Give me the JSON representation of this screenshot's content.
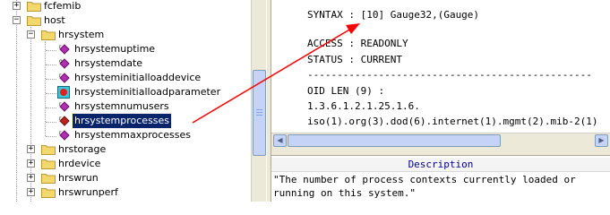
{
  "tree": {
    "nodes": [
      {
        "label": "fcfemib"
      },
      {
        "label": "host"
      },
      {
        "label": "hrsystem"
      },
      {
        "label": "hrsystemuptime"
      },
      {
        "label": "hrsystemdate"
      },
      {
        "label": "hrsysteminitialloaddevice"
      },
      {
        "label": "hrsysteminitialloadparameter"
      },
      {
        "label": "hrsystemnumusers"
      },
      {
        "label": "hrsystemprocesses"
      },
      {
        "label": "hrsystemmaxprocesses"
      },
      {
        "label": "hrstorage"
      },
      {
        "label": "hrdevice"
      },
      {
        "label": "hrswrun"
      },
      {
        "label": "hrswrunperf"
      }
    ],
    "selected": "hrsystemprocesses"
  },
  "info": {
    "syntax": "SYNTAX : [10] Gauge32,(Gauge)",
    "access": "ACCESS : READONLY",
    "status": "STATUS : CURRENT",
    "divider": "------------------------------------------------",
    "oid_len": "OID LEN (9) :",
    "oid": "1.3.6.1.2.1.25.1.6.",
    "oid_path": "iso(1).org(3).dod(6).internet(1).mgmt(2).mib-2(1)"
  },
  "description": {
    "title": "Description",
    "line1": "\"The number of process contexts currently loaded or",
    "line2": "running on this system.\""
  },
  "colors": {
    "selection": "#0a246a",
    "annotation_arrow": "#ff0000",
    "description_title": "#00008b"
  }
}
